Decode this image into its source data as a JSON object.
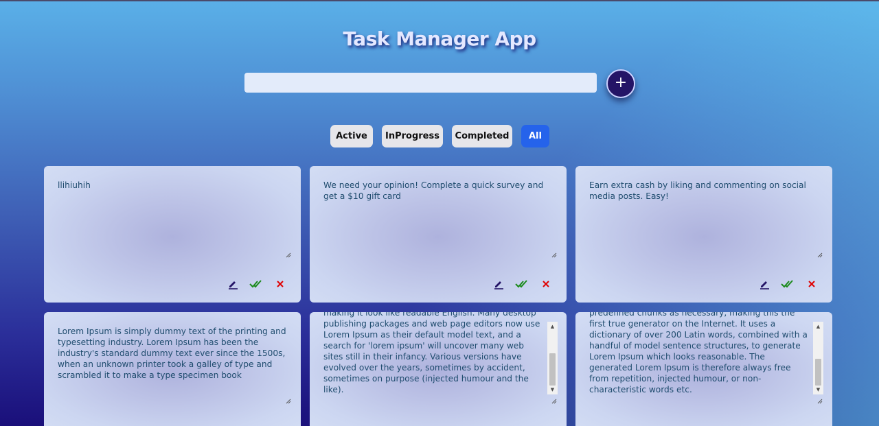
{
  "app": {
    "title": "Task Manager App"
  },
  "task_input": {
    "value": "",
    "placeholder": ""
  },
  "add_button": {
    "label": "+"
  },
  "filters": [
    {
      "label": "Active",
      "selected": false
    },
    {
      "label": "InProgress",
      "selected": false
    },
    {
      "label": "Completed",
      "selected": false
    },
    {
      "label": "All",
      "selected": true
    }
  ],
  "tasks": [
    {
      "text": "llihiuhih",
      "visible_text": "llihiuhih"
    },
    {
      "text": "We need your opinion! Complete a quick survey and get a $10 gift card"
    },
    {
      "text": "Earn extra cash by liking and commenting on social media posts. Easy!"
    },
    {
      "text": "Lorem Ipsum is simply dummy text of the printing and typesetting industry. Lorem Ipsum has been the industry's standard dummy text ever since the 1500s, when an unknown printer took a galley of type and scrambled it to make a type specimen book"
    },
    {
      "text": "making it look like readable English. Many desktop publishing packages and web page editors now use Lorem Ipsum as their default model text, and a search for 'lorem ipsum' will uncover many web sites still in their infancy. Various versions have evolved over the years, sometimes by accident, sometimes on purpose (injected humour and the like)."
    },
    {
      "text": "predefined chunks as necessary, making this the first true generator on the Internet. It uses a dictionary of over 200 Latin words, combined with a handful of model sentence structures, to generate Lorem Ipsum which looks reasonable. The generated Lorem Ipsum is therefore always free from repetition, injected humour, or non-characteristic words etc."
    }
  ],
  "icons": {
    "edit": "pencil-icon",
    "complete": "double-check-icon",
    "delete": "close-icon",
    "colors": {
      "edit": "#241466",
      "complete": "#1a8a1a",
      "delete": "#e00000"
    }
  },
  "colors": {
    "accent": "#2563eb",
    "add_button": "#241466"
  }
}
